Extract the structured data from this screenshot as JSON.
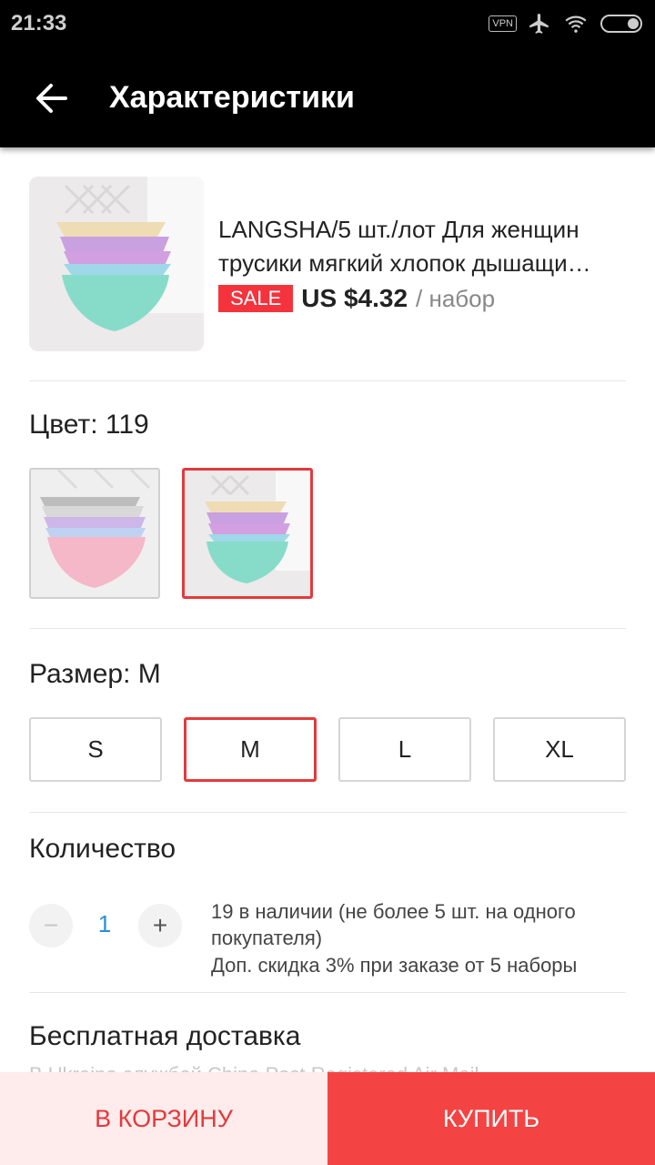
{
  "status_bar": {
    "time": "21:33",
    "vpn_label": "VPN",
    "icons": [
      "vpn-icon",
      "airplane-icon",
      "wifi-icon",
      "battery-icon"
    ]
  },
  "app_bar": {
    "title": "Характеристики",
    "back_icon": "arrow-left-icon"
  },
  "product": {
    "title_line1": "LANGSHA/5 шт./лот Для женщин",
    "title_line2": "трусики мягкий хлопок дышащи…",
    "sale_badge": "SALE",
    "price": "US $4.32",
    "price_unit": "/ набор",
    "image_icon": "product-photo-pastel-panties"
  },
  "color": {
    "label": "Цвет: 119",
    "options": [
      {
        "name": "pink-gray-set",
        "selected": false
      },
      {
        "name": "pastel-119-set",
        "selected": true
      }
    ]
  },
  "size": {
    "label": "Размер: M",
    "options": [
      "S",
      "M",
      "L",
      "XL"
    ],
    "selected": "M"
  },
  "quantity": {
    "label": "Количество",
    "value": "1",
    "minus": "−",
    "plus": "+",
    "stock_note": "19 в наличии (не более 5 шт. на одного покупателя)",
    "discount_note": "Доп. скидка 3% при заказе от 5 наборы"
  },
  "shipping": {
    "title": "Бесплатная доставка",
    "subtitle": "В Ukraine службой China Post Registered Air Mail"
  },
  "actions": {
    "cart": "В КОРЗИНУ",
    "buy": "КУПИТЬ"
  },
  "colors": {
    "accent": "#e4393c",
    "buy_button": "#f44343",
    "cart_background": "#fdeceb",
    "quantity_value": "#2a8fd6"
  }
}
